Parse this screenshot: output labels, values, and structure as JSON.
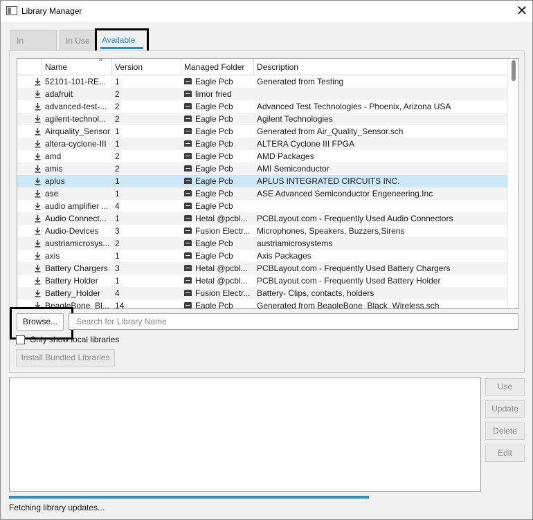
{
  "window": {
    "title": "Library Manager",
    "close_glyph": "✕",
    "icon": "app-window-icon"
  },
  "tabs": [
    {
      "label": "In Design",
      "active": false
    },
    {
      "label": "In Use",
      "active": false
    },
    {
      "label": "Available",
      "active": true
    }
  ],
  "table": {
    "sort_glyph": "^",
    "columns": [
      "",
      "Name",
      "Version",
      "Managed Folder",
      "Description"
    ],
    "rows": [
      {
        "name": "52101-101-RE...",
        "version": "1",
        "folder": "Eagle Pcb",
        "description": "Generated from Testing"
      },
      {
        "name": "adafruit",
        "version": "2",
        "folder": "limor fried",
        "description": ""
      },
      {
        "name": "advanced-test-...",
        "version": "2",
        "folder": "Eagle Pcb",
        "description": "Advanced Test Technologies - Phoenix, Arizona USA"
      },
      {
        "name": "agilent-technol...",
        "version": "2",
        "folder": "Eagle Pcb",
        "description": "Agilent Technologies"
      },
      {
        "name": "Airquality_Sensor",
        "version": "1",
        "folder": "Eagle Pcb",
        "description": "Generated from Air_Quality_Sensor.sch"
      },
      {
        "name": "altera-cyclone-III",
        "version": "1",
        "folder": "Eagle Pcb",
        "description": "ALTERA Cyclone III FPGA"
      },
      {
        "name": "amd",
        "version": "2",
        "folder": "Eagle Pcb",
        "description": "AMD Packages"
      },
      {
        "name": "amis",
        "version": "2",
        "folder": "Eagle Pcb",
        "description": "AMI Semiconductor"
      },
      {
        "name": "aplus",
        "version": "1",
        "folder": "Eagle Pcb",
        "description": "APLUS INTEGRATED CIRCUITS INC.",
        "selected": true
      },
      {
        "name": "ase",
        "version": "1",
        "folder": "Eagle Pcb",
        "description": "ASE Advanced Semiconductor Engeneering.Inc"
      },
      {
        "name": "audio amplifier ...",
        "version": "4",
        "folder": "Eagle Pcb",
        "description": ""
      },
      {
        "name": "Audio Connect...",
        "version": "1",
        "folder": "Hetal @pcbl...",
        "description": "PCBLayout.com - Frequently Used Audio Connectors"
      },
      {
        "name": "Audio-Devices",
        "version": "3",
        "folder": "Fusion Electr...",
        "description": "Microphones, Speakers, Buzzers,Sirens"
      },
      {
        "name": "austriamicrosys...",
        "version": "2",
        "folder": "Eagle Pcb",
        "description": "austriamicrosystems"
      },
      {
        "name": "axis",
        "version": "1",
        "folder": "Eagle Pcb",
        "description": "Axis Packages"
      },
      {
        "name": "Battery Chargers",
        "version": "3",
        "folder": "Hetal @pcbl...",
        "description": "PCBLayout.com - Frequently Used Battery Chargers"
      },
      {
        "name": "Battery Holder",
        "version": "1",
        "folder": "Hetal @pcbl...",
        "description": "PCBLayout.com - Frequently Used Battery Holder"
      },
      {
        "name": "Battery_Holder",
        "version": "4",
        "folder": "Fusion Electr...",
        "description": "Battery- Clips, contacts, holders"
      },
      {
        "name": "BeagleBone_Bl...",
        "version": "14",
        "folder": "Eagle Pcb",
        "description": "Generated from BeagleBone_Black_Wireless.sch"
      }
    ]
  },
  "browse_label": "Browse...",
  "search": {
    "value": "",
    "placeholder": "Search for Library Name"
  },
  "local_only": {
    "label": "Only show local libraries",
    "checked": false
  },
  "install_bundled_label": "Install Bundled Libraries",
  "actions": {
    "use": "Use",
    "update": "Update",
    "delete": "Delete",
    "edit": "Edit"
  },
  "progress_fraction": 1.0,
  "status_text": "Fetching library updates...",
  "colors": {
    "accent": "#2a8cd1",
    "selected_row": "#cde8f7"
  }
}
